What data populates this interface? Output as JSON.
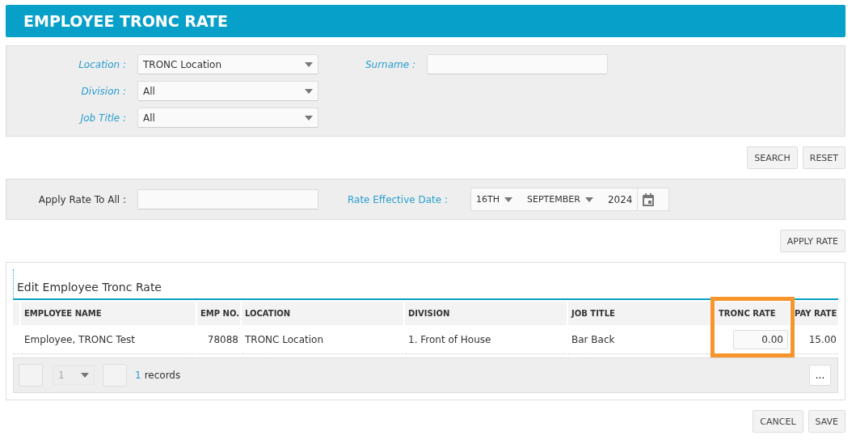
{
  "title": "EMPLOYEE TRONC RATE",
  "filter_columns": [
    [
      {
        "label": "Location :",
        "kind": "select",
        "value": "TRONC Location"
      },
      {
        "label": "Division :",
        "kind": "select",
        "value": "All"
      },
      {
        "label": "Job Title :",
        "kind": "select",
        "value": "All"
      }
    ],
    [
      {
        "label": "Surname :",
        "kind": "text"
      }
    ]
  ],
  "search_buttons": [
    "SEARCH",
    "RESET"
  ],
  "apply": {
    "rate_label": "Apply Rate To All :",
    "date_label": "Rate Effective Date :",
    "day": "16TH",
    "month": "SEPTEMBER",
    "year": "2024"
  },
  "apply_button": "APPLY RATE",
  "grid": {
    "title": "Edit Employee Tronc Rate",
    "columns": [
      {
        "label": "EMPLOYEE NAME",
        "kind": "text",
        "highlighted": false
      },
      {
        "label": "EMP NO.",
        "kind": "number",
        "highlighted": false
      },
      {
        "label": "LOCATION",
        "kind": "text",
        "highlighted": false
      },
      {
        "label": "DIVISION",
        "kind": "text",
        "highlighted": false
      },
      {
        "label": "JOB TITLE",
        "kind": "text",
        "highlighted": false
      },
      {
        "label": "TRONC RATE",
        "kind": "input",
        "highlighted": true
      },
      {
        "label": "PAY RATE",
        "kind": "number",
        "highlighted": false
      }
    ],
    "rows": [
      {
        "cells": [
          "Employee, TRONC Test",
          "78088",
          "TRONC Location",
          "1. Front of House",
          "Bar Back",
          "0.00",
          "15.00"
        ]
      }
    ],
    "pager": {
      "page": "1",
      "count": "1",
      "count_label": "records",
      "more": "..."
    }
  },
  "footer_buttons": [
    "CANCEL",
    "SAVE"
  ]
}
